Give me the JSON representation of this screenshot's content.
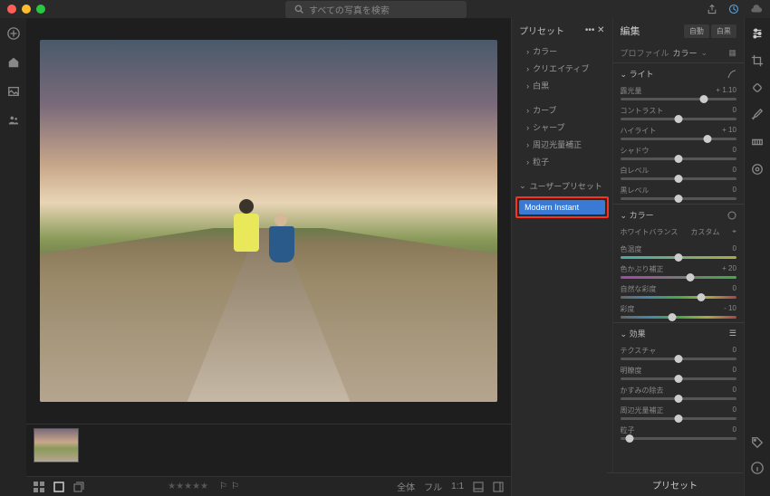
{
  "search": {
    "placeholder": "すべての写真を検索"
  },
  "presets": {
    "title": "プリセット",
    "groups": [
      "カラー",
      "クリエイティブ",
      "白黒"
    ],
    "groups2": [
      "カーブ",
      "シャープ",
      "周辺光量補正",
      "粒子"
    ],
    "user_group": "ユーザープリセット",
    "selected": "Modern Instant"
  },
  "edit": {
    "title": "編集",
    "auto": "自動",
    "bw": "白黒",
    "profile_label": "プロファイル",
    "profile_value": "カラー",
    "light": {
      "title": "ライト",
      "sliders": [
        {
          "label": "露光量",
          "value": "+ 1.10",
          "pos": 72
        },
        {
          "label": "コントラスト",
          "value": "0",
          "pos": 50
        },
        {
          "label": "ハイライト",
          "value": "+ 10",
          "pos": 75
        },
        {
          "label": "シャドウ",
          "value": "0",
          "pos": 50
        },
        {
          "label": "白レベル",
          "value": "0",
          "pos": 50
        },
        {
          "label": "黒レベル",
          "value": "0",
          "pos": 50
        }
      ]
    },
    "color": {
      "title": "カラー",
      "wb_label": "ホワイトバランス",
      "wb_value": "カスタム",
      "sliders": [
        {
          "label": "色温度",
          "value": "0",
          "pos": 50,
          "grad": "grad1"
        },
        {
          "label": "色かぶり補正",
          "value": "+ 20",
          "pos": 60,
          "grad": "grad2"
        },
        {
          "label": "自然な彩度",
          "value": "0",
          "pos": 70,
          "grad": "grad3"
        },
        {
          "label": "彩度",
          "value": "- 10",
          "pos": 45,
          "grad": "grad3"
        }
      ]
    },
    "effects": {
      "title": "効果",
      "sliders": [
        {
          "label": "テクスチャ",
          "value": "0",
          "pos": 50
        },
        {
          "label": "明瞭度",
          "value": "0",
          "pos": 50
        },
        {
          "label": "かすみの除去",
          "value": "0",
          "pos": 50
        },
        {
          "label": "周辺光量補正",
          "value": "0",
          "pos": 50
        },
        {
          "label": "粒子",
          "value": "0",
          "pos": 8
        }
      ]
    },
    "bottom_preset": "プリセット"
  },
  "bottom": {
    "fit": "全体",
    "full": "フル",
    "one": "1:1"
  }
}
